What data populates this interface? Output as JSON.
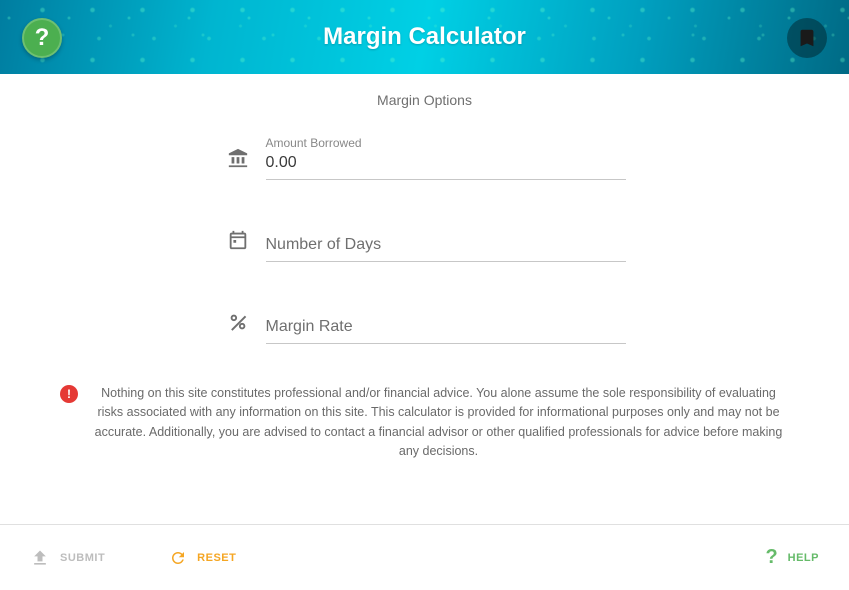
{
  "header": {
    "title": "Margin Calculator"
  },
  "subtitle": "Margin Options",
  "fields": {
    "amount": {
      "label": "Amount Borrowed",
      "value": "0.00"
    },
    "days": {
      "placeholder": "Number of Days",
      "value": ""
    },
    "rate": {
      "placeholder": "Margin Rate",
      "value": ""
    }
  },
  "disclaimer": {
    "text": "Nothing on this site constitutes professional and/or financial advice. You alone assume the sole responsibility of evaluating risks associated with any information on this site. This calculator is provided for informational purposes only and may not be accurate. Additionally, you are advised to contact a financial advisor or other qualified professionals for advice before making any decisions.",
    "icon_label": "!"
  },
  "footer": {
    "submit": "SUBMIT",
    "reset": "RESET",
    "help": "HELP"
  },
  "icons": {
    "help_header": "?",
    "help_footer": "?"
  },
  "colors": {
    "accent_green": "#4caf50",
    "accent_orange": "#f5a623",
    "danger_red": "#e53935",
    "header_teal": "#00b5d0"
  }
}
